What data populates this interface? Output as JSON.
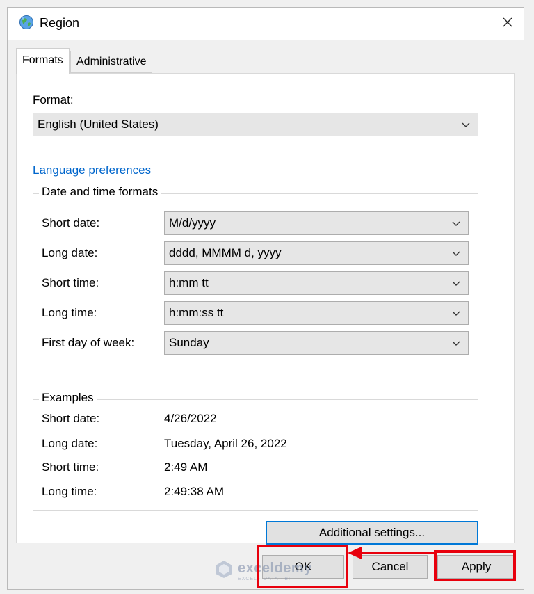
{
  "window": {
    "title": "Region",
    "close_glyph": "✕"
  },
  "tabs": [
    {
      "label": "Formats",
      "active": true
    },
    {
      "label": "Administrative",
      "active": false
    }
  ],
  "format": {
    "label": "Format:",
    "value": "English (United States)"
  },
  "language_link": "Language preferences",
  "date_time_formats": {
    "title": "Date and time formats",
    "rows": [
      {
        "label": "Short date:",
        "value": "M/d/yyyy"
      },
      {
        "label": "Long date:",
        "value": "dddd, MMMM d, yyyy"
      },
      {
        "label": "Short time:",
        "value": "h:mm tt"
      },
      {
        "label": "Long time:",
        "value": "h:mm:ss tt"
      },
      {
        "label": "First day of week:",
        "value": "Sunday"
      }
    ]
  },
  "examples": {
    "title": "Examples",
    "rows": [
      {
        "label": "Short date:",
        "value": "4/26/2022"
      },
      {
        "label": "Long date:",
        "value": "Tuesday, April 26, 2022"
      },
      {
        "label": "Short time:",
        "value": "2:49 AM"
      },
      {
        "label": "Long time:",
        "value": "2:49:38 AM"
      }
    ]
  },
  "buttons": {
    "additional_settings": "Additional settings...",
    "ok": "OK",
    "cancel": "Cancel",
    "apply": "Apply"
  },
  "watermark": {
    "name": "exceldemy",
    "tagline": "EXCEL · DATA · BI"
  },
  "icons": {
    "app": "globe-icon",
    "close": "close-icon",
    "dropdown": "chevron-down-icon"
  },
  "colors": {
    "highlight": "#e8000d",
    "link": "#0066cc",
    "focus": "#0078d7"
  }
}
